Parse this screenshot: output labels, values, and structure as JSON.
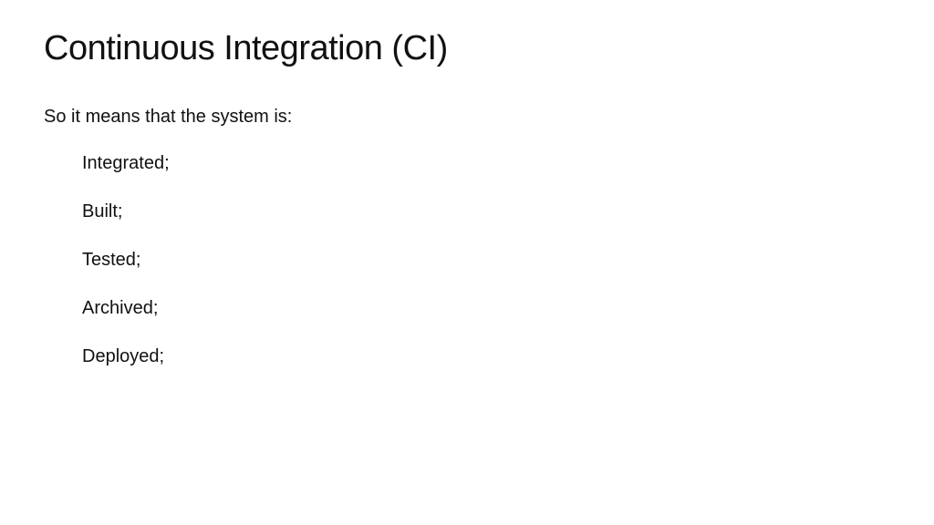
{
  "title": "Continuous Integration (CI)",
  "intro": "So it means that the system is:",
  "items": [
    "Integrated;",
    "Built;",
    "Tested;",
    "Archived;",
    "Deployed;"
  ]
}
